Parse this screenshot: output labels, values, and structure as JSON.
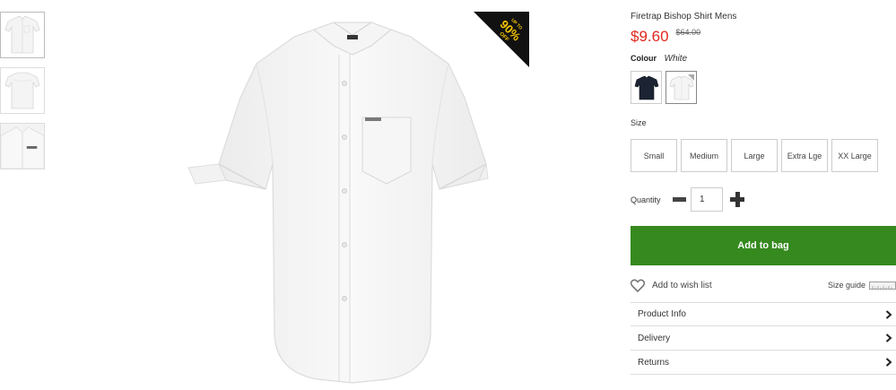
{
  "thumbnails": [
    {
      "icon": "shirt-front-thumbnail"
    },
    {
      "icon": "shirt-back-thumbnail"
    },
    {
      "icon": "shirt-detail-thumbnail"
    }
  ],
  "badge": {
    "line1": "UP TO",
    "line2": "90%",
    "line3": "OFF"
  },
  "product": {
    "title": "Firetrap Bishop Shirt Mens",
    "price": "$9.60",
    "was_price": "$64.00"
  },
  "colour": {
    "label": "Colour",
    "value": "White",
    "swatches": [
      {
        "name": "Navy",
        "color": "#1c2433"
      },
      {
        "name": "White",
        "color": "#ffffff",
        "selected": true
      }
    ]
  },
  "size": {
    "label": "Size",
    "options": [
      "Small",
      "Medium",
      "Large",
      "Extra Lge",
      "XX Large"
    ]
  },
  "quantity": {
    "label": "Quantity",
    "value": "1"
  },
  "add_to_bag": "Add to bag",
  "wishlist": "Add to wish list",
  "size_guide": "Size guide",
  "accordion": [
    "Product Info",
    "Delivery",
    "Returns"
  ],
  "colors": {
    "accent_green": "#35891e",
    "price_red": "#e0261d",
    "badge_black": "#111111",
    "badge_yellow": "#f5c400"
  }
}
